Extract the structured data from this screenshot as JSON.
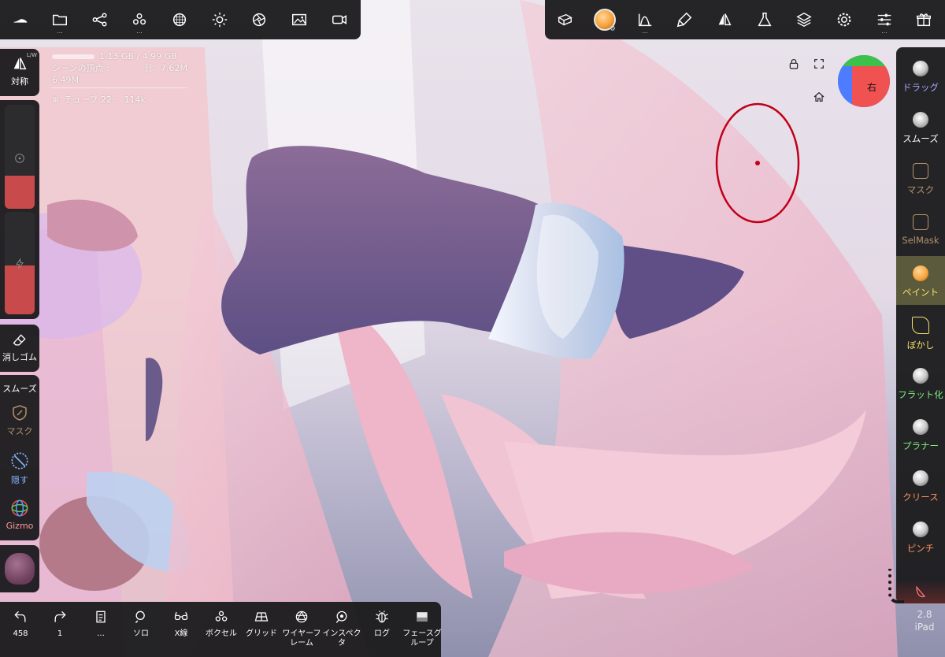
{
  "app": {
    "version": "2.8",
    "device": "iPad"
  },
  "colors": {
    "accent_red": "#c94a4a",
    "active_tool_bg": "#5b5a3c",
    "selection_circle": "#c0001a",
    "paint_orange": "#f6a23a"
  },
  "top_left_toolbar": {
    "icons": [
      "shoe-icon",
      "folder-icon",
      "share-nodes-icon",
      "voxel-icon",
      "sphere-grid-icon",
      "sun-icon",
      "aperture-icon",
      "image-icon",
      "video-icon"
    ]
  },
  "top_right_toolbar": {
    "icons": [
      "box-tool-icon",
      "paint-material-icon",
      "curve-icon",
      "brush-stamp-icon",
      "symmetry-icon",
      "flask-icon",
      "layers-icon",
      "gear-icon",
      "sliders-icon",
      "gift-icon"
    ]
  },
  "stats": {
    "memory": "1.13 GB / 4.99 GB",
    "vertices": "シーンの頂点 : 6.49M",
    "links": "7.62M",
    "mesh": "チューブ 22",
    "mesh_count": "114k"
  },
  "left_panel": {
    "symmetry": {
      "label": "対称",
      "tag": "L/W"
    },
    "eraser": "消しゴム",
    "smooth": "スムーズ",
    "mask": "マスク",
    "hide": "隠す",
    "gizmo": "Gizmo"
  },
  "view_cube": {
    "label": "右"
  },
  "right_tools": [
    {
      "label": "ドラッグ",
      "color": "#a9a8ff"
    },
    {
      "label": "スムーズ",
      "color": "#ffffff"
    },
    {
      "label": "マスク",
      "color": "#b3916b"
    },
    {
      "label": "SelMask",
      "color": "#b3916b"
    },
    {
      "label": "ペイント",
      "color": "#f3e06a"
    },
    {
      "label": "ぼかし",
      "color": "#f3e06a"
    },
    {
      "label": "フラット化",
      "color": "#7ff07f"
    },
    {
      "label": "プラナー",
      "color": "#7ff07f"
    },
    {
      "label": "クリース",
      "color": "#ff9060"
    },
    {
      "label": "ピンチ",
      "color": "#ff9060"
    }
  ],
  "bottom_toolbar": {
    "undo_count": "458",
    "redo_count": "1",
    "items": [
      {
        "label": "...",
        "icon": "document-icon"
      },
      {
        "label": "ソロ",
        "icon": "magnifier-icon"
      },
      {
        "label": "X線",
        "icon": "xray-glasses-icon"
      },
      {
        "label": "ボクセル",
        "icon": "voxel-icon"
      },
      {
        "label": "グリッド",
        "icon": "grid-icon"
      },
      {
        "label": "ワイヤーフレーム",
        "icon": "wireframe-icon"
      },
      {
        "label": "インスペクタ",
        "icon": "eye-icon"
      },
      {
        "label": "ログ",
        "icon": "bug-icon"
      },
      {
        "label": "フェースグループ",
        "icon": "facegroup-icon"
      }
    ]
  }
}
